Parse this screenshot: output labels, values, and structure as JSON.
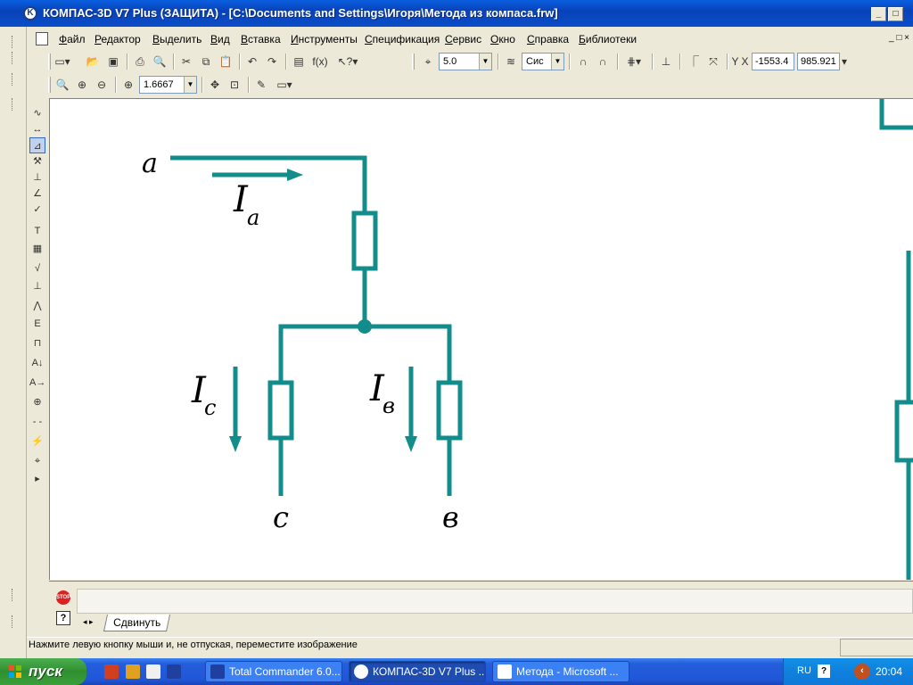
{
  "window": {
    "title": "КОМПАС-3D V7 Plus (ЗАЩИТА) - [C:\\Documents and Settings\\Игоря\\Метода из компаса.frw]",
    "minimize": "_",
    "maximize": "□",
    "close": "X"
  },
  "menu": {
    "items": [
      "Файл",
      "Редактор",
      "Выделить",
      "Вид",
      "Вставка",
      "Инструменты",
      "Спецификация",
      "Сервис",
      "Окно",
      "Справка",
      "Библиотеки"
    ],
    "doc_buttons": "_ □ ×"
  },
  "toolbar": {
    "step_value": "5.0",
    "layer_value": "Сис",
    "coord_x": "-1553.4",
    "coord_y": "985.921",
    "zoom_value": "1.6667",
    "fx_label": "f(x)",
    "xy_label": "Y X"
  },
  "drawing": {
    "node_a": "a",
    "current_a": "I",
    "current_a_sub": "a",
    "current_c": "I",
    "current_c_sub": "c",
    "current_b": "I",
    "current_b_sub": "в",
    "node_c": "c",
    "node_b": "в",
    "wire_color": "#138c8c"
  },
  "bottom": {
    "stop_label": "STOP",
    "help_label": "?",
    "tab_label": "Сдвинуть",
    "tab_nav": "◂ ▸"
  },
  "status": {
    "text": "Нажмите левую кнопку мыши и, не отпуская, переместите изображение"
  },
  "taskbar": {
    "start_label": "пуск",
    "tasks": [
      "Total Commander 6.0...",
      "КОМПАС-3D V7 Plus ...",
      "Метода - Microsoft ..."
    ],
    "lang": "RU",
    "clock": "20:04"
  }
}
